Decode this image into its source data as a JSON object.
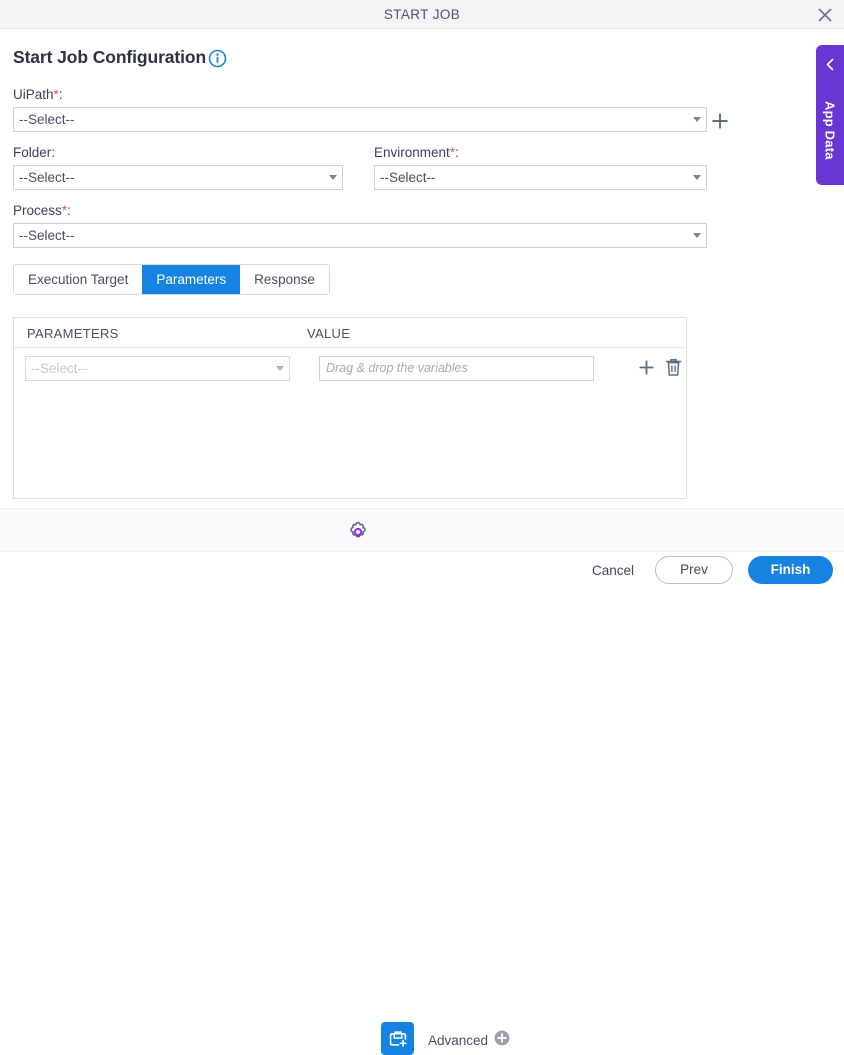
{
  "window": {
    "title": "START JOB",
    "close_icon": "close-icon"
  },
  "header": {
    "page_title": "Start Job Configuration",
    "info_icon": "info-circle-icon"
  },
  "form": {
    "uipath": {
      "label": "UiPath",
      "required_marker": "*",
      "colon": ":",
      "value": "--Select--",
      "add_icon": "plus-icon"
    },
    "folder": {
      "label": "Folder",
      "required_marker": "",
      "colon": ":",
      "value": "--Select--"
    },
    "environment": {
      "label": "Environment",
      "required_marker": "*",
      "colon": ":",
      "value": "--Select--"
    },
    "process": {
      "label": "Process",
      "required_marker": "*",
      "colon": ":",
      "value": "--Select--"
    }
  },
  "tabs": [
    {
      "label": "Execution Target",
      "active": false
    },
    {
      "label": "Parameters",
      "active": true
    },
    {
      "label": "Response",
      "active": false
    }
  ],
  "parameters_table": {
    "columns": [
      "PARAMETERS",
      "VALUE"
    ],
    "rows": [
      {
        "parameter_value": "--Select--",
        "value_placeholder": "Drag & drop the variables",
        "value_text": "",
        "add_icon": "plus-icon",
        "delete_icon": "trash-icon"
      }
    ]
  },
  "app_data_panel": {
    "label": "App Data",
    "collapse_icon": "chevron-left-icon",
    "color": "#6936d3"
  },
  "toolbar": {
    "settings_icon": "gear-icon",
    "job_icon": "briefcase-plus-icon",
    "advanced_label": "Advanced",
    "advanced_add_icon": "plus-circle-icon"
  },
  "footer": {
    "cancel_label": "Cancel",
    "prev_label": "Prev",
    "finish_label": "Finish"
  },
  "colors": {
    "accent_blue": "#1683e2",
    "purple": "#6936d3",
    "required_red": "#d1604d",
    "title_slate": "#4a5573"
  }
}
